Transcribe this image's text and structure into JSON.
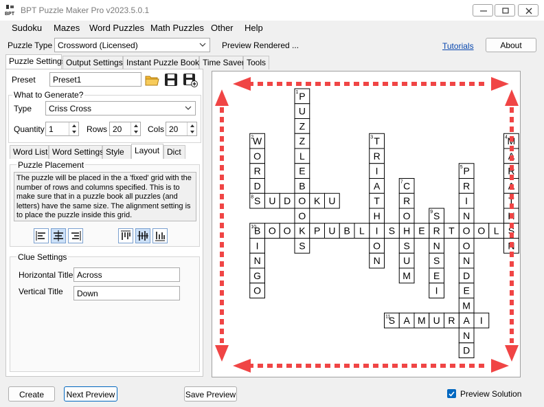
{
  "window": {
    "title": "BPT Puzzle Maker Pro v2023.5.0.1",
    "controls": [
      "minimize",
      "restore",
      "close"
    ]
  },
  "menu": [
    "Sudoku",
    "Mazes",
    "Word Puzzles",
    "Math Puzzles",
    "Other",
    "Help"
  ],
  "toolbar": {
    "puzzle_type_label": "Puzzle Type",
    "puzzle_type_value": "Crossword (Licensed)",
    "status": "Preview Rendered ...",
    "tutorials_link": "Tutorials",
    "about_button": "About"
  },
  "main_tabs": [
    "Puzzle Settings",
    "Output Settings",
    "Instant Puzzle Books",
    "Time Saver",
    "Tools"
  ],
  "active_main_tab": "Puzzle Settings",
  "preset": {
    "label": "Preset",
    "value": "Preset1",
    "icons": [
      "folder-open-icon",
      "save-icon",
      "save-as-icon"
    ]
  },
  "generate": {
    "title": "What to Generate?",
    "type_label": "Type",
    "type_value": "Criss Cross",
    "quantity_label": "Quantity",
    "quantity_value": "1",
    "rows_label": "Rows",
    "rows_value": "20",
    "cols_label": "Cols",
    "cols_value": "20"
  },
  "sub_tabs": [
    "Word List",
    "Word Settings",
    "Style",
    "Layout",
    "Dict"
  ],
  "active_sub_tab": "Layout",
  "placement": {
    "title": "Puzzle Placement",
    "description": "The puzzle will be placed in the a 'fixed' grid with the number of rows and columns specified. This is to make sure that in a puzzle book all puzzles (and letters) have the same size. The alignment setting is to place the puzzle inside this grid.",
    "horizontal_align": [
      "align-left-icon",
      "align-center-icon",
      "align-right-icon"
    ],
    "horizontal_selected": 1,
    "vertical_align": [
      "align-top-icon",
      "align-middle-icon",
      "align-bottom-icon"
    ],
    "vertical_selected": 1
  },
  "clues": {
    "title": "Clue Settings",
    "horizontal_label": "Horizontal Title",
    "horizontal_value": "Across",
    "vertical_label": "Vertical Title",
    "vertical_value": "Down"
  },
  "bottom": {
    "create": "Create",
    "next_preview": "Next Preview",
    "save_preview": "Save Preview",
    "preview_solution_label": "Preview Solution",
    "preview_solution_checked": true
  },
  "puzzle": {
    "accent_arrow_color": "#f04545",
    "words": [
      {
        "num": "1",
        "word": "PUZZLEBOOKS",
        "dir": "down",
        "row": 0,
        "col": 4
      },
      {
        "num": "2",
        "word": "WORDS",
        "dir": "down",
        "row": 3,
        "col": 1
      },
      {
        "num": "3",
        "word": "TRIATHLON",
        "dir": "down",
        "row": 3,
        "col": 9
      },
      {
        "num": "4",
        "word": "MARATHON",
        "dir": "down",
        "row": 3,
        "col": 18
      },
      {
        "num": "5",
        "word": "PRINTONDEMAND",
        "dir": "down",
        "row": 5,
        "col": 15
      },
      {
        "num": "6",
        "word": "WORDSEARCH",
        "dir": "down",
        "row": 5,
        "col": 20
      },
      {
        "num": "7",
        "word": "CROSSUM",
        "dir": "down",
        "row": 6,
        "col": 11
      },
      {
        "num": "8",
        "word": "SUDOKU",
        "dir": "across",
        "row": 7,
        "col": 1
      },
      {
        "num": "9",
        "word": "SENSEI",
        "dir": "down",
        "row": 8,
        "col": 13
      },
      {
        "num": "10",
        "word": "BOOKPUBLISHERTOOLS",
        "dir": "across",
        "row": 9,
        "col": 1
      },
      {
        "num": "10",
        "word": "BINGO",
        "dir": "down",
        "row": 9,
        "col": 1
      },
      {
        "num": "11",
        "word": "SAMURAI",
        "dir": "across",
        "row": 15,
        "col": 10
      }
    ]
  }
}
